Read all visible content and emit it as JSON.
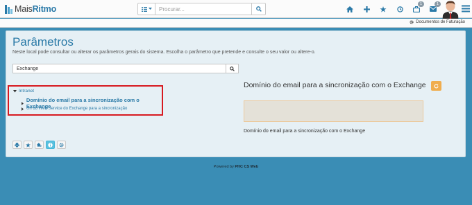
{
  "brand": {
    "name_prefix": "Mais",
    "name_suffix": "Ritmo"
  },
  "search": {
    "placeholder": "Procurar..."
  },
  "nav": {
    "icons": [
      "home-icon",
      "plus-icon",
      "star-icon",
      "clock-icon",
      "briefcase-icon",
      "mail-icon"
    ],
    "briefcase_badge": "1",
    "mail_badge": "1"
  },
  "subbar": {
    "doc_link_label": "Documentos de Faturação"
  },
  "page": {
    "title": "Parâmetros",
    "description": "Neste local pode consultar ou alterar os parâmetros gerais do sistema. Escolha o parâmetro que pretende e consulte o seu valor ou altere-o."
  },
  "filter": {
    "value": "Exchange"
  },
  "tree": {
    "root_label": "Intranet",
    "children": [
      {
        "label": "Domínio do email para a sincronização com o Exchange",
        "selected": true
      },
      {
        "label": "Url do Web Service do Exchange para a sincronização",
        "selected": false
      }
    ]
  },
  "detail": {
    "title": "Domínio do email para a sincronização com o Exchange",
    "value": "",
    "description": "Domínio do email para a sincronização com o Exchange"
  },
  "tools": [
    "print-icon",
    "star-icon",
    "add-icon",
    "info-icon",
    "gear-icon"
  ],
  "footer": {
    "prefix": "Powered by",
    "product": "PHC CS Web"
  },
  "colors": {
    "accent": "#2a7aa7",
    "background": "#3a8db5",
    "warning": "#f0ad4e",
    "highlight": "#d7191f"
  }
}
